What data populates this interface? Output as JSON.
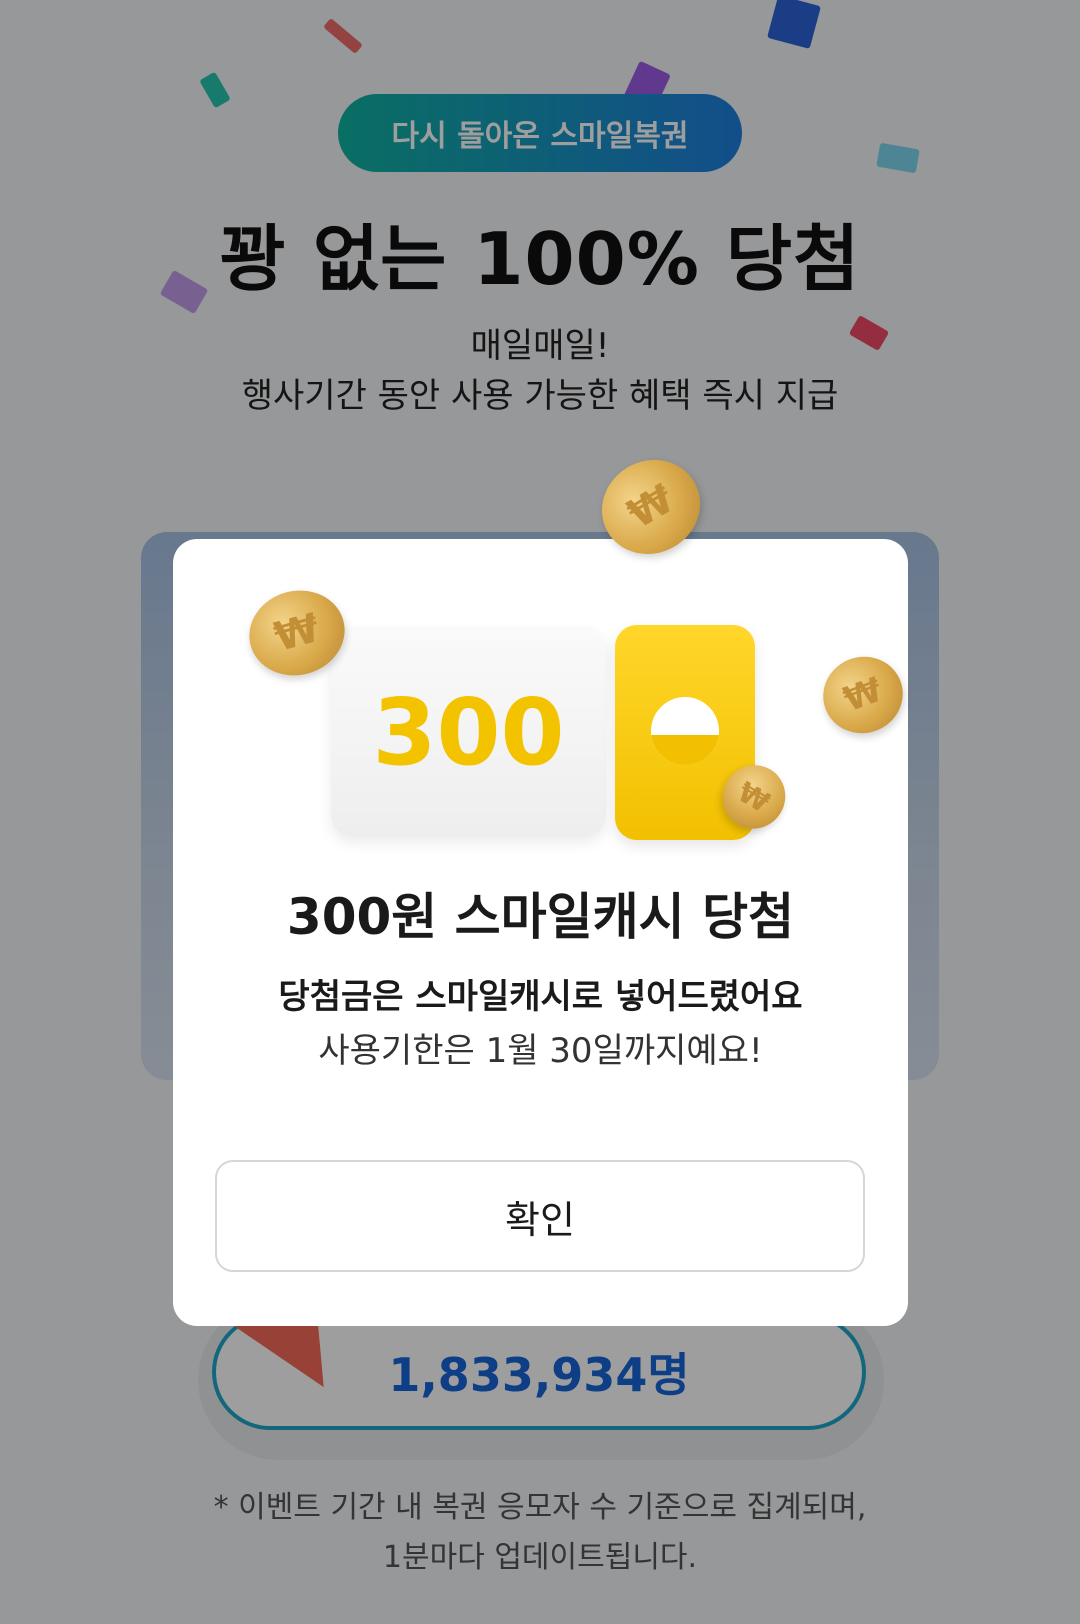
{
  "event": {
    "badge": "다시 돌아온 스마일복권",
    "headline": "꽝 없는 100% 당첨",
    "subtitle_line1": "매일매일!",
    "subtitle_line2": "행사기간 동안 사용 가능한 혜택 즉시 지급"
  },
  "counter": {
    "value": "1,833,934명"
  },
  "footnote": {
    "line1": "* 이벤트 기간 내 복권 응모자 수 기준으로 집계되며,",
    "line2": "1분마다 업데이트됩니다."
  },
  "modal": {
    "prize_amount": "300",
    "title": "300원 스마일캐시 당첨",
    "line1": "당첨금은 스마일캐시로 넣어드렸어요",
    "line2": "사용기한은 1월 30일까지예요!",
    "confirm_label": "확인"
  },
  "colors": {
    "badge_gradient_start": "#0fb3a0",
    "badge_gradient_end": "#1f7ee0",
    "counter_text": "#1565d8",
    "prize_yellow": "#f3c300"
  }
}
